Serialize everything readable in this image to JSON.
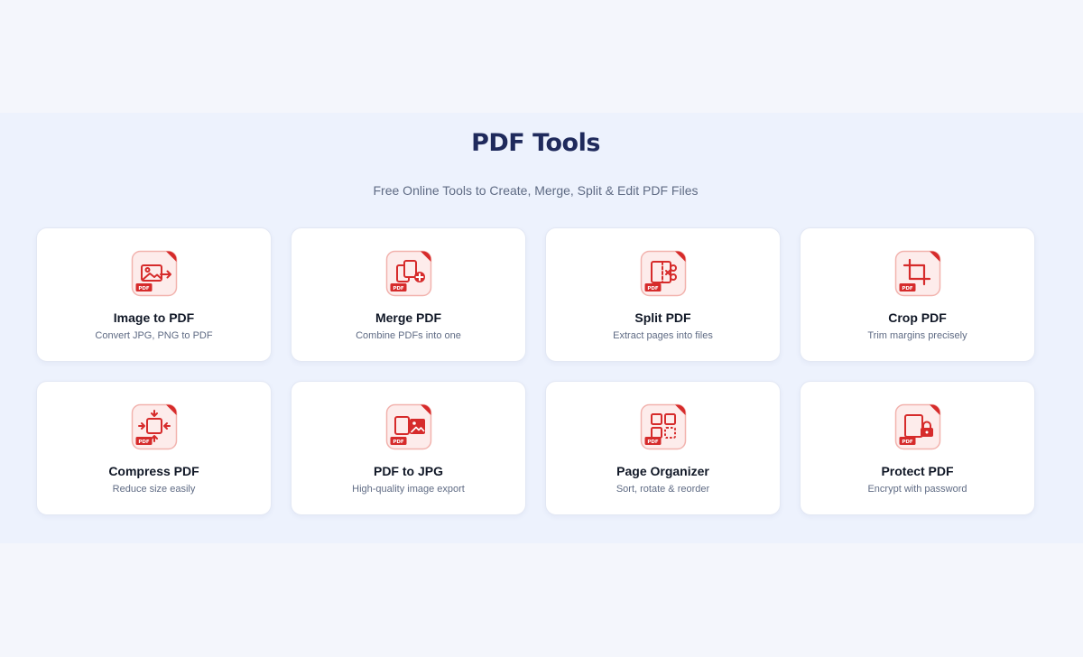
{
  "header": {
    "title": "PDF Tools",
    "subtitle": "Free Online Tools to Create, Merge, Split & Edit PDF Files"
  },
  "theme": {
    "accent": "#d62b2b",
    "icon_bg": "#fdeceb",
    "title_color": "#1f2a5c"
  },
  "tools": [
    {
      "icon": "image-to-pdf-icon",
      "title": "Image to PDF",
      "desc": "Convert JPG, PNG to PDF",
      "badge": "PDF"
    },
    {
      "icon": "merge-pdf-icon",
      "title": "Merge PDF",
      "desc": "Combine PDFs into one",
      "badge": "PDF"
    },
    {
      "icon": "split-pdf-icon",
      "title": "Split PDF",
      "desc": "Extract pages into files",
      "badge": "PDF"
    },
    {
      "icon": "crop-pdf-icon",
      "title": "Crop PDF",
      "desc": "Trim margins precisely",
      "badge": "PDF"
    },
    {
      "icon": "compress-pdf-icon",
      "title": "Compress PDF",
      "desc": "Reduce size easily",
      "badge": "PDF"
    },
    {
      "icon": "pdf-to-jpg-icon",
      "title": "PDF to JPG",
      "desc": "High-quality image export",
      "badge": "PDF"
    },
    {
      "icon": "page-organizer-icon",
      "title": "Page Organizer",
      "desc": "Sort, rotate & reorder",
      "badge": "PDF"
    },
    {
      "icon": "protect-pdf-icon",
      "title": "Protect PDF",
      "desc": "Encrypt with password",
      "badge": "PDF"
    }
  ]
}
